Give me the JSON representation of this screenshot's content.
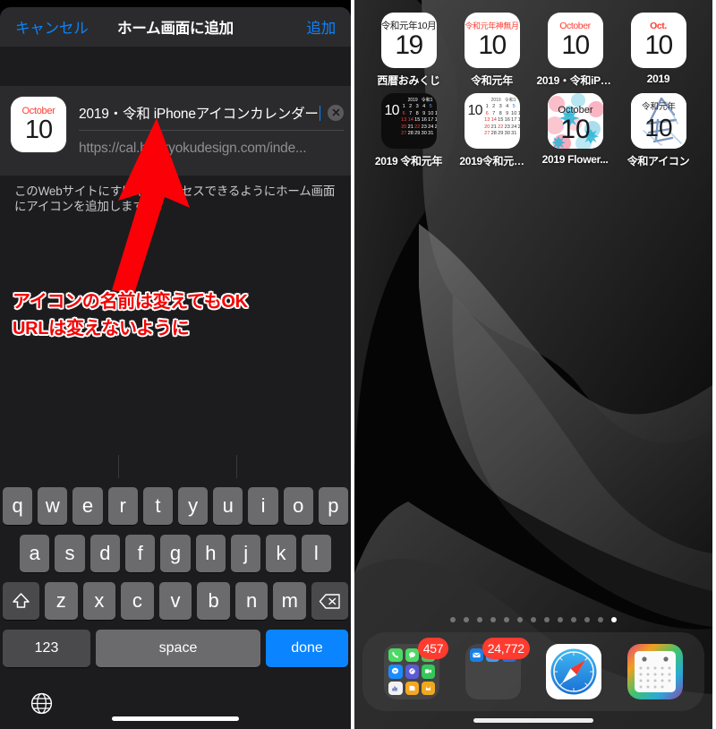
{
  "left_panel": {
    "nav": {
      "cancel_label": "キャンセル",
      "title": "ホーム画面に追加",
      "add_label": "追加"
    },
    "form": {
      "icon": {
        "month": "October",
        "day": "10"
      },
      "name_value": "2019・令和 iPhoneアイコンカレンダー",
      "url_value": "https://cal.hokkyokudesign.com/inde...",
      "clear_icon": "clear-circle-icon"
    },
    "helper_text": "このWebサイトにすばやくアクセスできるようにホーム画面にアイコンを追加します。",
    "annotation": {
      "line1": "アイコンの名前は変えてもOK",
      "line2": "URLは変えないように",
      "color": "#f50000",
      "arrow_icon": "red-arrow-icon"
    },
    "keyboard": {
      "row1": [
        "q",
        "w",
        "e",
        "r",
        "t",
        "y",
        "u",
        "i",
        "o",
        "p"
      ],
      "row2": [
        "a",
        "s",
        "d",
        "f",
        "g",
        "h",
        "j",
        "k",
        "l"
      ],
      "row3": [
        "z",
        "x",
        "c",
        "v",
        "b",
        "n",
        "m"
      ],
      "shift_icon": "shift-arrow-icon",
      "backspace_icon": "backspace-icon",
      "numbers_label": "123",
      "space_label": "space",
      "done_label": "done",
      "globe_icon": "globe-icon",
      "done_color": "#0a84ff"
    }
  },
  "right_panel": {
    "apps_row1": [
      {
        "label": "西暦おみくじ",
        "month": "令和元年10月",
        "day": "19",
        "month_color": "#1a1a1a",
        "style": "text"
      },
      {
        "label": "令和元年",
        "month": "令和元年神無月",
        "day": "10",
        "month_color": "#ff3b30",
        "style": "text"
      },
      {
        "label": "2019・令和iPh...",
        "month": "October",
        "day": "10",
        "month_color": "#ff3b30",
        "style": "text"
      },
      {
        "label": "2019",
        "month": "Oct.",
        "day": "10",
        "month_color": "#ff3b30",
        "style": "text"
      }
    ],
    "apps_row2": [
      {
        "label": "2019 令和元年",
        "style": "minical-dark",
        "year": "2019",
        "era": "令和1",
        "big": "10"
      },
      {
        "label": "2019令和元…",
        "style": "minical-light",
        "year": "2019",
        "era": "令和1",
        "big": "10"
      },
      {
        "label": "2019  Flower...",
        "style": "flower",
        "month": "October",
        "day": "10"
      },
      {
        "label": "令和アイコン",
        "style": "calligraphy",
        "month": "令和元年",
        "day": "10"
      }
    ],
    "minical": {
      "rows": [
        [
          "1",
          "2",
          "3",
          "4",
          "5"
        ],
        [
          "6",
          "7",
          "8",
          "9",
          "10",
          "11",
          "12"
        ],
        [
          "13",
          "14",
          "15",
          "16",
          "17",
          "18",
          "19"
        ],
        [
          "20",
          "21",
          "22",
          "23",
          "24",
          "25",
          "26"
        ],
        [
          "27",
          "28",
          "29",
          "30",
          "31"
        ]
      ]
    },
    "page_dots": {
      "count": 13,
      "active_index": 12
    },
    "dock": {
      "items": [
        {
          "name": "sns-folder",
          "badge": "457"
        },
        {
          "name": "mail-folder",
          "badge": "24,772"
        },
        {
          "name": "safari-app",
          "badge": ""
        },
        {
          "name": "calendar-app",
          "badge": ""
        }
      ]
    }
  }
}
